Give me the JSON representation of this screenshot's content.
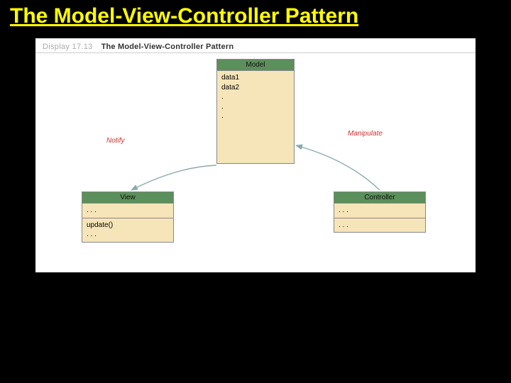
{
  "slide": {
    "title": "The Model-View-Controller Pattern"
  },
  "figure": {
    "display_label": "Display 17.13",
    "caption": "The Model-View-Controller Pattern"
  },
  "model": {
    "title": "Model",
    "body": "data1\ndata2\n  .\n  .\n  ."
  },
  "view": {
    "title": "View",
    "section1": ". . .",
    "section2": "update()\n. . ."
  },
  "controller": {
    "title": "Controller",
    "section1": ". . .",
    "section2": ". . ."
  },
  "edges": {
    "notify": "Notify",
    "manipulate": "Manipulate"
  }
}
